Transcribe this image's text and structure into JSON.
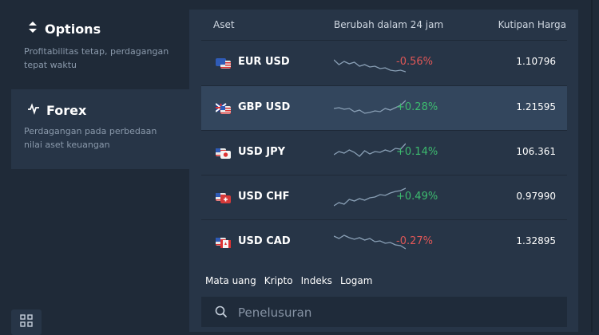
{
  "sidebar": {
    "categories": [
      {
        "title": "Options",
        "desc": "Profitabilitas tetap, perdagangan tepat waktu",
        "icon": "up-down-arrows-icon"
      },
      {
        "title": "Forex",
        "desc": "Perdagangan pada perbedaan nilai aset keuangan",
        "icon": "pulse-icon"
      }
    ]
  },
  "table": {
    "headers": {
      "asset": "Aset",
      "change": "Berubah dalam 24 jam",
      "quote": "Kutipan Harga"
    },
    "rows": [
      {
        "pair": "EUR USD",
        "change": "-0.56%",
        "quote": "1.10796",
        "trend": "down",
        "flag": "eu-us-flag-icon",
        "spark": [
          14,
          20,
          16,
          19,
          17,
          22,
          20,
          23,
          22,
          25,
          24,
          27,
          28,
          27,
          29
        ]
      },
      {
        "pair": "GBP USD",
        "change": "+0.28%",
        "quote": "1.21595",
        "trend": "up",
        "flag": "gb-us-flag-icon",
        "spark": [
          18,
          17,
          19,
          18,
          22,
          20,
          24,
          23,
          21,
          22,
          18,
          20,
          17,
          14,
          8
        ]
      },
      {
        "pair": "USD JPY",
        "change": "+0.14%",
        "quote": "106.361",
        "trend": "up",
        "flag": "us-jp-flag-icon",
        "spark": [
          20,
          16,
          18,
          14,
          17,
          22,
          15,
          19,
          16,
          17,
          14,
          16,
          12,
          13,
          6
        ]
      },
      {
        "pair": "USD CHF",
        "change": "+0.49%",
        "quote": "0.97990",
        "trend": "up",
        "flag": "us-ch-flag-icon",
        "spark": [
          28,
          24,
          26,
          20,
          22,
          19,
          21,
          18,
          17,
          14,
          15,
          12,
          10,
          9,
          6
        ]
      },
      {
        "pair": "USD CAD",
        "change": "-0.27%",
        "quote": "1.32895",
        "trend": "down",
        "flag": "us-ca-flag-icon",
        "spark": [
          10,
          13,
          9,
          12,
          14,
          12,
          15,
          13,
          17,
          16,
          19,
          18,
          21,
          22,
          26
        ]
      }
    ]
  },
  "tabs": [
    "Mata uang",
    "Kripto",
    "Indeks",
    "Logam"
  ],
  "search": {
    "placeholder": "Penelusuran"
  },
  "colors": {
    "negative": "#e05757",
    "positive": "#3dbb6f",
    "sparkline": "#8aa0b6"
  }
}
